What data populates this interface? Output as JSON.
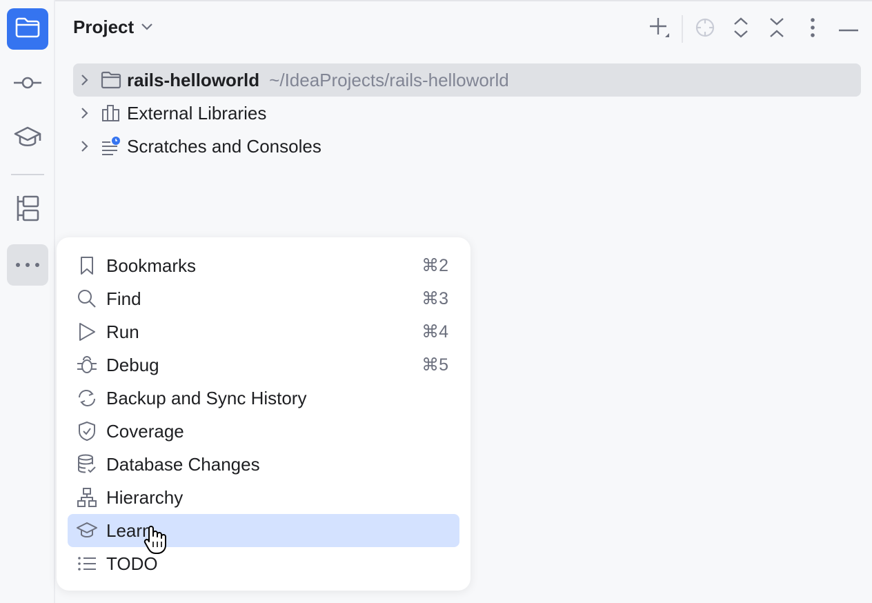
{
  "colors": {
    "accent": "#3574f0",
    "selection": "#dfe1e5",
    "highlight": "#d4e2ff",
    "muted_text": "#818594",
    "icon": "#6c707e"
  },
  "stripe": {
    "buttons": [
      {
        "icon": "folder-icon",
        "active": true
      },
      {
        "icon": "commit-icon"
      },
      {
        "icon": "learn-icon"
      },
      {
        "icon": "structure-icon"
      },
      {
        "icon": "more-icon"
      }
    ]
  },
  "header": {
    "title": "Project",
    "icons": [
      "add-icon",
      "locate-icon",
      "expand-all-icon",
      "collapse-all-icon",
      "options-icon",
      "minimize-icon"
    ]
  },
  "tree": [
    {
      "label": "rails-helloworld",
      "path": "~/IdeaProjects/rails-helloworld",
      "icon": "folder-icon",
      "selected": true
    },
    {
      "label": "External Libraries",
      "icon": "libraries-icon"
    },
    {
      "label": "Scratches and Consoles",
      "icon": "scratches-icon"
    }
  ],
  "menu": {
    "items": [
      {
        "label": "Bookmarks",
        "shortcut": "⌘2",
        "icon": "bookmark-icon"
      },
      {
        "label": "Find",
        "shortcut": "⌘3",
        "icon": "search-icon"
      },
      {
        "label": "Run",
        "shortcut": "⌘4",
        "icon": "run-icon"
      },
      {
        "label": "Debug",
        "shortcut": "⌘5",
        "icon": "debug-icon"
      },
      {
        "label": "Backup and Sync History",
        "icon": "sync-icon"
      },
      {
        "label": "Coverage",
        "icon": "shield-check-icon"
      },
      {
        "label": "Database Changes",
        "icon": "database-icon"
      },
      {
        "label": "Hierarchy",
        "icon": "hierarchy-icon"
      },
      {
        "label": "Learn",
        "icon": "learn-icon",
        "highlighted": true
      },
      {
        "label": "TODO",
        "icon": "list-icon"
      }
    ]
  }
}
